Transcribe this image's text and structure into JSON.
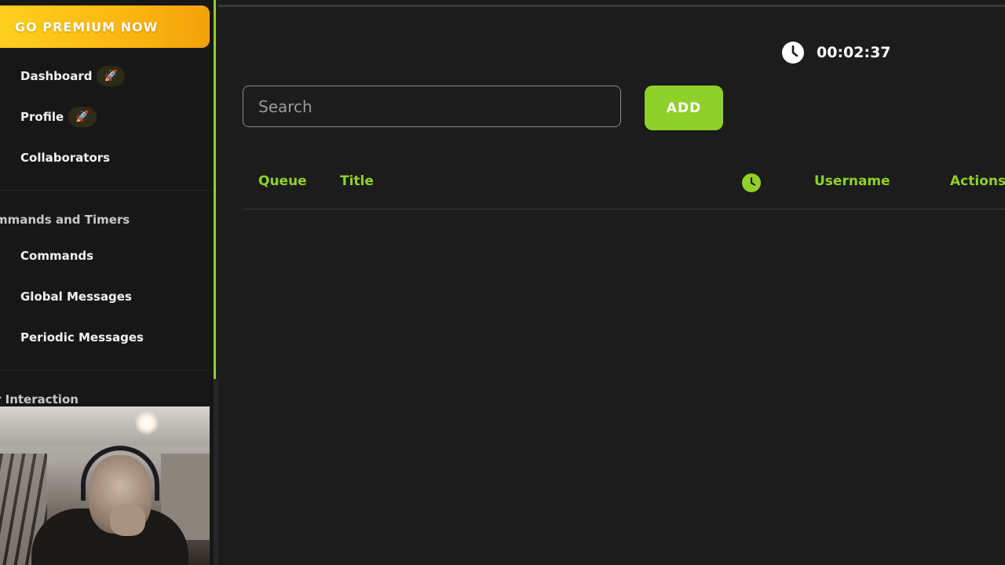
{
  "sidebar": {
    "premium_label": "GO PREMIUM NOW",
    "items": [
      {
        "label": "Dashboard",
        "badge_icon": "rocket-icon"
      },
      {
        "label": "Profile",
        "badge_icon": "rocket-icon"
      },
      {
        "label": "Collaborators"
      }
    ],
    "section_commands": {
      "title": "mmands and Timers",
      "items": [
        {
          "label": "Commands"
        },
        {
          "label": "Global Messages"
        },
        {
          "label": "Periodic Messages"
        }
      ]
    },
    "section_interaction": {
      "title": "r Interaction"
    }
  },
  "timer": {
    "icon": "clock-icon",
    "value": "00:02:37"
  },
  "search": {
    "placeholder": "Search"
  },
  "add_button": {
    "label": "ADD"
  },
  "table": {
    "columns": [
      "Queue",
      "Title",
      "clock-icon",
      "Username",
      "Actions"
    ],
    "headers": {
      "queue": "Queue",
      "title": "Title",
      "username": "Username",
      "actions": "Actions"
    },
    "rows": []
  },
  "colors": {
    "accent": "#8fd12a",
    "premium": "#fbb710",
    "background": "#1c1c1c",
    "sidebar": "#171717"
  }
}
